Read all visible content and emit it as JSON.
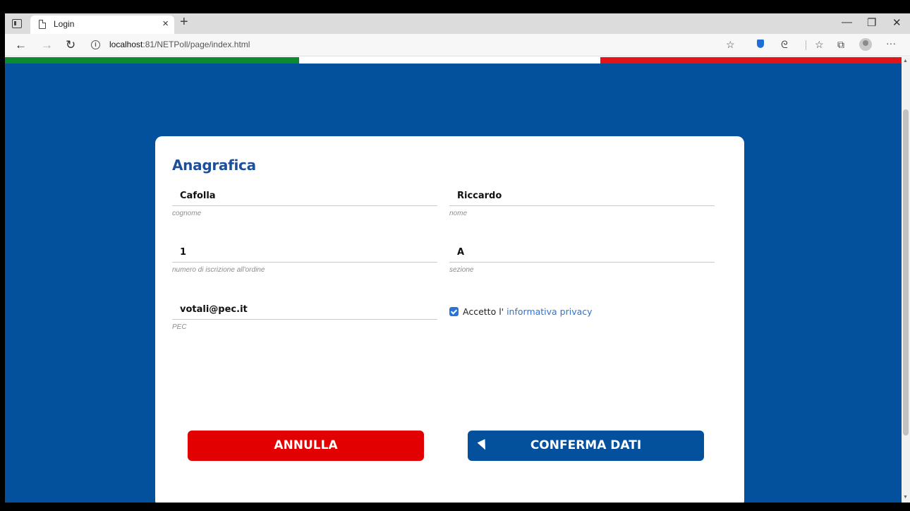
{
  "browser": {
    "tab_title": "Login",
    "tab_close": "×",
    "new_tab": "+",
    "url_host": "localhost",
    "url_rest": ":81/NETPoll/page/index.html",
    "back": "←",
    "forward": "→",
    "reload": "↻",
    "info": "i",
    "minimize": "—",
    "maximize": "❐",
    "close": "✕",
    "more": "···",
    "icons": [
      "tab-actions-icon",
      "page-icon",
      "add-favorite-icon",
      "extension-shield-icon",
      "refresh-extension-icon",
      "favorites-icon",
      "collections-icon",
      "profile-icon"
    ]
  },
  "colors": {
    "page_bg": "#03519c",
    "flag_green": "#0b8a32",
    "flag_white": "#ffffff",
    "flag_red": "#e4141b",
    "cancel": "#e30000",
    "confirm": "#03519c"
  },
  "form": {
    "title": "Anagrafica",
    "fields": {
      "cognome": {
        "value": "Cafolla",
        "hint": "cognome"
      },
      "nome": {
        "value": "Riccardo",
        "hint": "nome"
      },
      "numero": {
        "value": "1",
        "hint": "numero di iscrizione all'ordine"
      },
      "sezione": {
        "value": "A",
        "hint": "sezione"
      },
      "pec": {
        "value": "votali@pec.it",
        "hint": "PEC"
      }
    },
    "privacy": {
      "checked": true,
      "prefix": "Accetto l' ",
      "link": "informativa privacy"
    },
    "buttons": {
      "cancel": "ANNULLA",
      "confirm": "CONFERMA DATI"
    }
  }
}
